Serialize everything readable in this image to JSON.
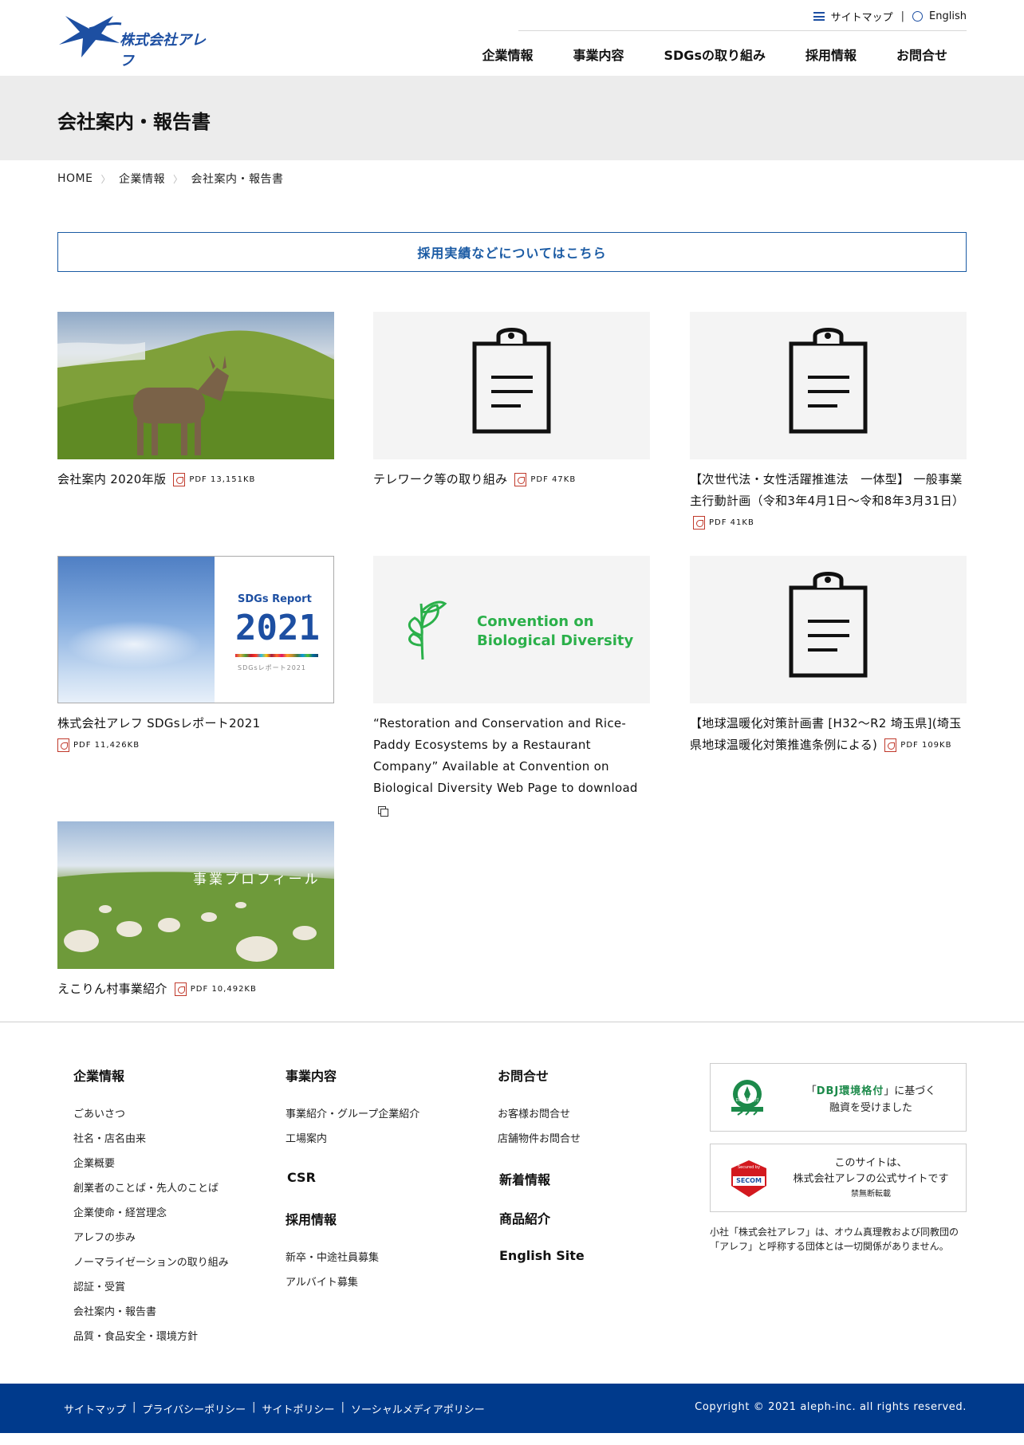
{
  "header": {
    "logo_text": "株式会社アレフ",
    "util": {
      "sitemap": "サイトマップ",
      "english": "English"
    },
    "nav": [
      "企業情報",
      "事業内容",
      "SDGsの取り組み",
      "採用情報",
      "お問合せ"
    ]
  },
  "page": {
    "title": "会社案内・報告書",
    "breadcrumb": [
      "HOME",
      "企業情報",
      "会社案内・報告書"
    ],
    "recruit_link": "採用実績などについてはこちら"
  },
  "cards": [
    {
      "text": "会社案内 2020年版",
      "file": "PDF 13,151KB"
    },
    {
      "text": "テレワーク等の取り組み",
      "file": "PDF 47KB"
    },
    {
      "text": "【次世代法・女性活躍推進法　一体型】 一般事業主行動計画（令和3年4月1日～令和8年3月31日）",
      "file": "PDF 41KB"
    },
    {
      "text": "株式会社アレフ SDGsレポート2021",
      "file": "PDF 11,426KB",
      "thumb": {
        "title": "SDGs Report",
        "year": "2021",
        "sub": "SDGsレポート2021"
      }
    },
    {
      "text": "“Restoration and Conservation and Rice-Paddy Ecosystems by a Restaurant Company” Available at Convention on Biological Diversity Web Page to download",
      "thumb": {
        "line1": "Convention on",
        "line2": "Biological Diversity"
      }
    },
    {
      "text": "【地球温暖化対策計画書 [H32〜R2 埼玉県](埼玉県地球温暖化対策推進条例による)",
      "file": "PDF 109KB"
    },
    {
      "text": "えこりん村事業紹介",
      "file": "PDF 10,492KB",
      "thumb": {
        "title": "事業プロフィール"
      }
    }
  ],
  "footer": {
    "company": {
      "heading": "企業情報",
      "items": [
        "ごあいさつ",
        "社名・店名由来",
        "企業概要",
        "創業者のことば・先人のことば",
        "企業使命・経営理念",
        "アレフの歩み",
        "ノーマライゼーションの取り組み",
        "認証・受賞",
        "会社案内・報告書",
        "品質・食品安全・環境方針"
      ]
    },
    "business": {
      "heading": "事業内容",
      "items": [
        "事業紹介・グループ企業紹介",
        "工場案内"
      ]
    },
    "csr": "CSR",
    "recruit": {
      "heading": "採用情報",
      "items": [
        "新卒・中途社員募集",
        "アルバイト募集"
      ]
    },
    "contact": {
      "heading": "お問合せ",
      "items": [
        "お客様お問合せ",
        "店舗物件お問合せ"
      ]
    },
    "news": "新着情報",
    "products": "商品紹介",
    "english_site": "English Site",
    "dbj": {
      "badge": "DBJ環境格付",
      "line1_pre": "「",
      "line1_em": "DBJ環境格付",
      "line1_post": "」に基づく",
      "line2": "融資を受けました"
    },
    "secom": {
      "badge_top": "Secured by",
      "badge_name": "SECOM",
      "line1": "このサイトは、",
      "line2": "株式会社アレフの公式サイトです",
      "line3": "禁無断転載"
    },
    "note": "小社「株式会社アレフ」は、オウム真理教および同教団の「アレフ」と呼称する団体とは一切関係がありません。"
  },
  "bottom": {
    "links": [
      "サイトマップ",
      "プライバシーポリシー",
      "サイトポリシー",
      "ソーシャルメディアポリシー"
    ],
    "copyright": "Copyright © 2021 aleph-inc. all rights reserved."
  },
  "colors": {
    "brand": "#003a8c",
    "link_blue": "#1b5ba4",
    "pdf_red": "#c0392b",
    "cbd_green": "#2bb04a"
  }
}
